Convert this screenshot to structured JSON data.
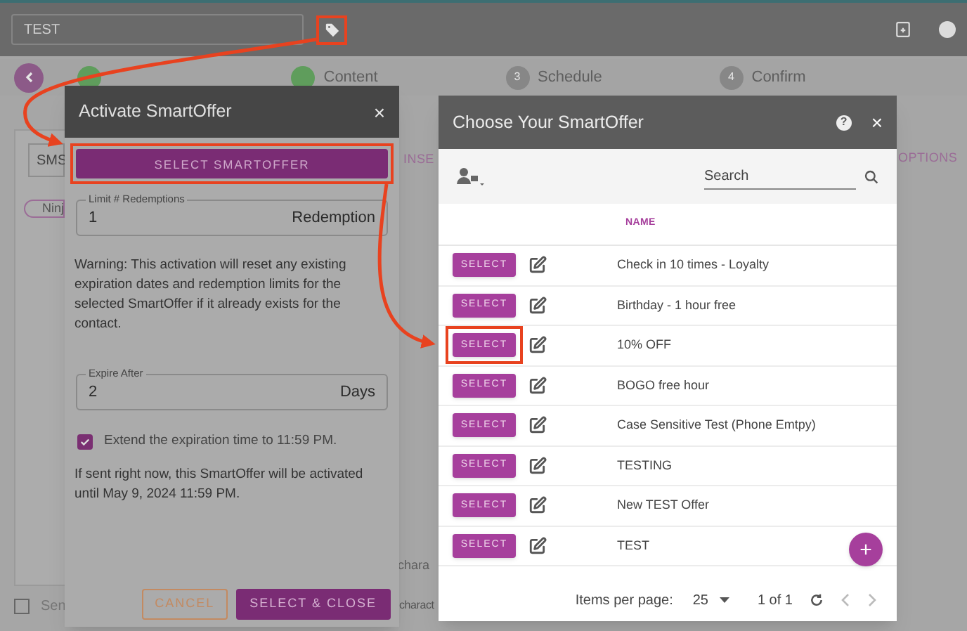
{
  "top_bar": {
    "campaign_name": "TEST",
    "tag_annotated": true
  },
  "stepper": [
    {
      "completed": true
    },
    {
      "label": "Content",
      "completed": true
    },
    {
      "number": "3",
      "label": "Schedule",
      "completed": false
    },
    {
      "number": "4",
      "label": "Confirm",
      "completed": false
    }
  ],
  "compose": {
    "channel": "SMS",
    "insert": "INSE",
    "options": "OPTIONS",
    "chip": "Ninj",
    "char_count_top": "chara",
    "send_checkbox": {
      "label": "Sen",
      "checked": false
    },
    "char_count_bottom": "charact"
  },
  "activate_dialog": {
    "title": "Activate SmartOffer",
    "close": "×",
    "select_button": {
      "label": "SELECT SMARTOFFER",
      "annotated": true
    },
    "limit_field": {
      "label": "Limit # Redemptions",
      "value": "1",
      "suffix": "Redemption"
    },
    "warning": "Warning: This activation will reset any existing expiration dates and redemption limits for the selected SmartOffer if it already exists for the contact.",
    "expire_field": {
      "label": "Expire After",
      "value": "2",
      "suffix": "Days"
    },
    "extend": {
      "label": "Extend the expiration time to 11:59 PM.",
      "checked": true
    },
    "note": "If sent right now, this SmartOffer will be activated until May 9, 2024 11:59 PM.",
    "cancel": "CANCEL",
    "confirm": "SELECT & CLOSE"
  },
  "choose_dialog": {
    "title": "Choose Your SmartOffer",
    "help": "?",
    "close": "×",
    "search": {
      "placeholder": "Search"
    },
    "column": "NAME",
    "rows": [
      {
        "select": "SELECT",
        "name": "Check in 10 times - Loyalty",
        "annotated": false
      },
      {
        "select": "SELECT",
        "name": "Birthday - 1 hour free",
        "annotated": false
      },
      {
        "select": "SELECT",
        "name": "10% OFF",
        "annotated": true
      },
      {
        "select": "SELECT",
        "name": "BOGO free hour",
        "annotated": false
      },
      {
        "select": "SELECT",
        "name": "Case Sensitive Test (Phone Emtpy)",
        "annotated": false
      },
      {
        "select": "SELECT",
        "name": "TESTING",
        "annotated": false
      },
      {
        "select": "SELECT",
        "name": "New TEST Offer",
        "annotated": false
      },
      {
        "select": "SELECT",
        "name": "TEST",
        "annotated": false
      }
    ],
    "add": "+",
    "pagination": {
      "label": "Items per page:",
      "size": "25",
      "range": "1 of 1"
    }
  }
}
